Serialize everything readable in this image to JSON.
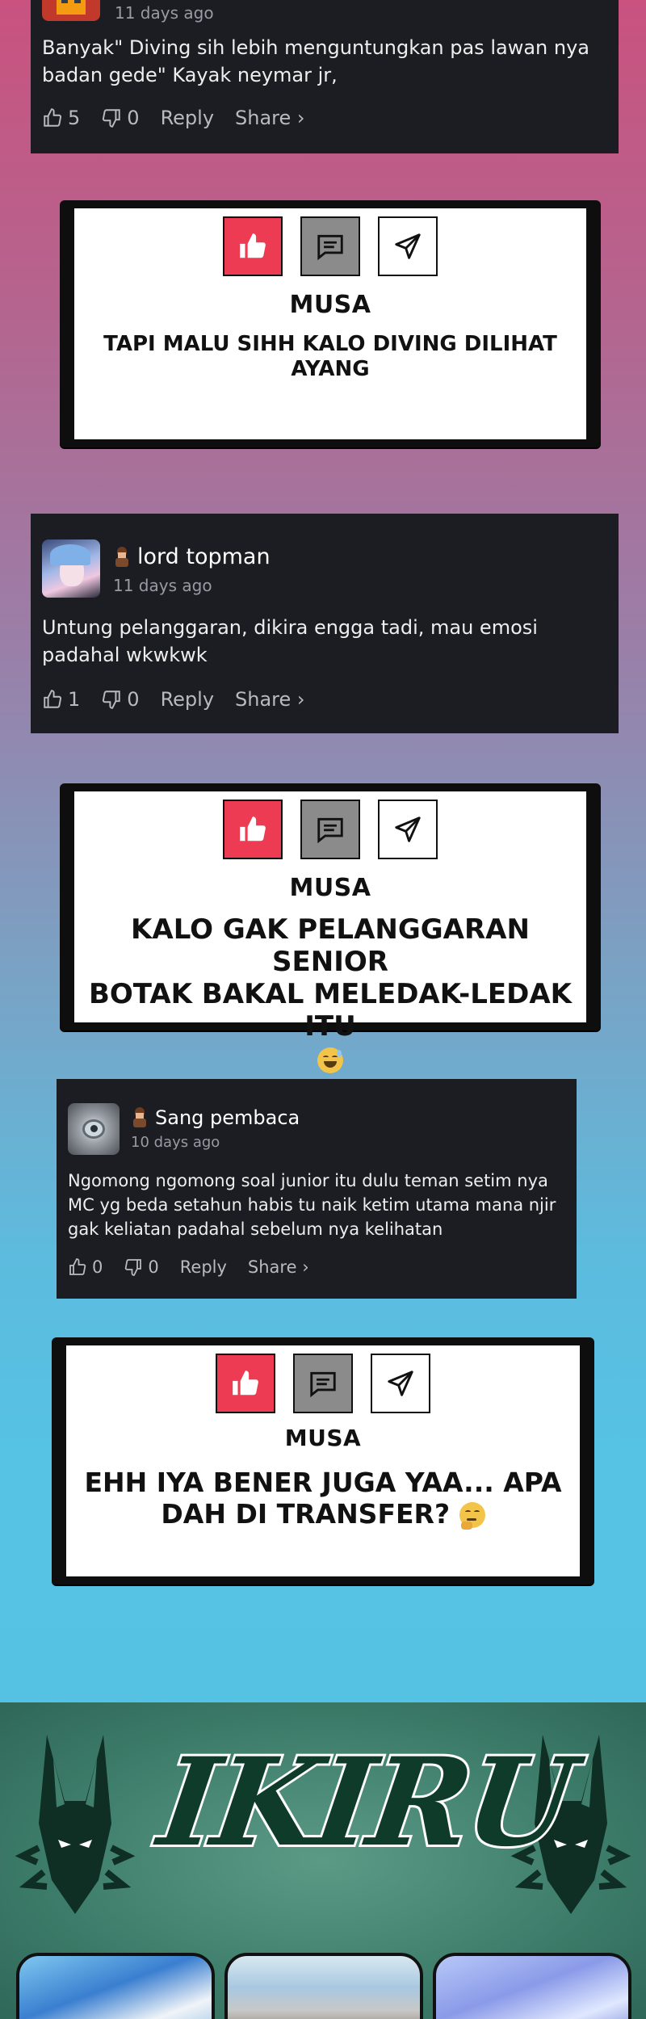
{
  "comments": [
    {
      "username": "",
      "time": "11 days ago",
      "text": "Banyak\" Diving sih lebih menguntungkan pas lawan nya badan gede\" Kayak neymar jr,",
      "likes": "5",
      "dislikes": "0",
      "reply_label": "Reply",
      "share_label": "Share ›"
    },
    {
      "username": "lord topman",
      "time": "11 days ago",
      "text": "Untung pelanggaran, dikira engga tadi, mau emosi padahal wkwkwk",
      "likes": "1",
      "dislikes": "0",
      "reply_label": "Reply",
      "share_label": "Share ›"
    },
    {
      "username": "Sang pembaca",
      "time": "10 days ago",
      "text": "Ngomong ngomong soal junior itu dulu teman setim nya MC yg beda setahun habis tu naik ketim utama mana njir gak keliatan padahal sebelum nya kelihatan",
      "likes": "0",
      "dislikes": "0",
      "reply_label": "Reply",
      "share_label": "Share ›"
    }
  ],
  "replies": [
    {
      "speaker": "MUSA",
      "line1": "TAPI MALU SIHH KALO DIVING DILIHAT AYANG",
      "line2": "",
      "line3": ""
    },
    {
      "speaker": "MUSA",
      "line1": "KALO GAK PELANGGARAN SENIOR",
      "line2": "BOTAK BAKAL MELEDAK-LEDAK ITU",
      "line3": ""
    },
    {
      "speaker": "MUSA",
      "line1": "EHH IYA BENER JUGA YAA... APA",
      "line2": "DAH DI TRANSFER?",
      "line3": ""
    }
  ],
  "banner": {
    "logo_text": "IKIRU"
  },
  "icons": {
    "like": "thumbs-up-icon",
    "dislike": "thumbs-down-icon",
    "chat": "chat-icon",
    "send": "send-icon",
    "rank": "rank-badge-icon"
  },
  "colors": {
    "card_bg": "#1c1c23",
    "like_red": "#ec3b52",
    "chat_grey": "#8b8b8b",
    "banner_green": "#3f7f6c",
    "logo_dark": "#0e3b2a"
  }
}
